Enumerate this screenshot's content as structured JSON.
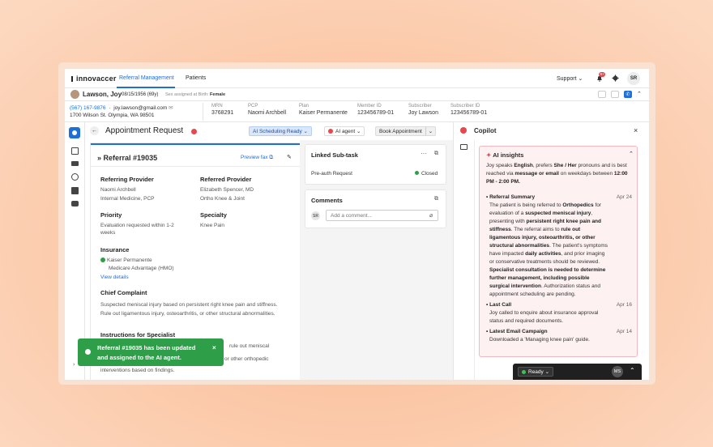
{
  "nav": {
    "brand": "innovaccer",
    "links": [
      "Referral Management",
      "Patients"
    ],
    "support": "Support",
    "notif_badge": "9+",
    "user_initials": "SR"
  },
  "patient": {
    "name": "Lawson, Joy",
    "dob": "08/15/1956 (69y)",
    "sex_label": "Sex assigned at Birth:",
    "sex_value": "Female",
    "phone": "(567) 167-9876",
    "email": "joy.lawson@gmail.com",
    "address": "1700 Wilson St. Olympia, WA 98501",
    "fields": [
      {
        "label": "MRN",
        "value": "3768291"
      },
      {
        "label": "PCP",
        "value": "Naomi Archbell"
      },
      {
        "label": "Plan",
        "value": "Kaiser Permanente"
      },
      {
        "label": "Member ID",
        "value": "123456789-01"
      },
      {
        "label": "Subscriber",
        "value": "Joy Lawson"
      },
      {
        "label": "Subscriber ID",
        "value": "123456789-01"
      }
    ]
  },
  "page": {
    "title": "Appointment Request",
    "status_btn": "AI Scheduling Ready",
    "agent_btn": "AI agent",
    "book_btn": "Book Appointment"
  },
  "referral": {
    "id": "Referral #19035",
    "preview": "Preview fax",
    "referring_provider_label": "Referring Provider",
    "referring_provider": "Naomi Archbell",
    "referring_specialty": "Internal Medicine, PCP",
    "referred_provider_label": "Referred Provider",
    "referred_provider": "Elizabeth Spencer, MD",
    "referred_specialty": "Ortho Knee & Joint",
    "priority_label": "Priority",
    "priority": "Evaluation requested within 1-2 weeks",
    "specialty_label": "Specialty",
    "specialty": "Knee Pain",
    "insurance_label": "Insurance",
    "insurance_name": "Kaiser Permanente",
    "insurance_plan": "Medicare Advantage (HMO)",
    "view_details": "View details",
    "complaint_label": "Chief Complaint",
    "complaint": "Suspected meniscal injury based on persistent right knee pain and stiffness. Rule out ligamentous injury, osteoarthritis, or other structural abnormalities.",
    "instructions_label": "Instructions for Specialist",
    "instructions_1": "rule out meniscal",
    "instructions_2": "or other orthopedic",
    "instructions_3": "interventions based on findings."
  },
  "subtask": {
    "title": "Linked Sub-task",
    "item": "Pre-auth Request",
    "status": "Closed"
  },
  "comments": {
    "title": "Comments",
    "avatar": "SR",
    "placeholder": "Add a comment..."
  },
  "copilot": {
    "title": "Copilot",
    "insights_title": "AI insights",
    "intro": [
      {
        "t": "Joy speaks ",
        "b": false
      },
      {
        "t": "English",
        "b": true
      },
      {
        "t": ", prefers ",
        "b": false
      },
      {
        "t": "She / Her",
        "b": true
      },
      {
        "t": " pronouns and is best reached via ",
        "b": false
      },
      {
        "t": "message or email",
        "b": true
      },
      {
        "t": " on weekdays between ",
        "b": false
      },
      {
        "t": "12:00 PM - 2:00 PM.",
        "b": true
      }
    ],
    "items": [
      {
        "title": "Referral Summary",
        "date": "Apr 24",
        "parts": [
          {
            "t": "The patient is being referred to ",
            "b": false
          },
          {
            "t": "Orthopedics",
            "b": true
          },
          {
            "t": " for evaluation of a ",
            "b": false
          },
          {
            "t": "suspected meniscal injury",
            "b": true
          },
          {
            "t": ", presenting with ",
            "b": false
          },
          {
            "t": "persistent right knee pain and stiffness",
            "b": true
          },
          {
            "t": ". The referral aims to ",
            "b": false
          },
          {
            "t": "rule out ligamentous injury, osteoarthritis, or other structural abnormalities",
            "b": true
          },
          {
            "t": ". The patient's symptoms have impacted ",
            "b": false
          },
          {
            "t": "daily activities",
            "b": true
          },
          {
            "t": ", and prior imaging or conservative treatments should be reviewed. ",
            "b": false
          },
          {
            "t": "Specialist consultation is needed to determine further management, including possible surgical intervention",
            "b": true
          },
          {
            "t": ". Authorization status and appointment scheduling are pending.",
            "b": false
          }
        ]
      },
      {
        "title": "Last Call",
        "date": "Apr 16",
        "parts": [
          {
            "t": "Joy called to enquire about insurance approval status and required documents.",
            "b": false
          }
        ]
      },
      {
        "title": "Latest Email Campaign",
        "date": "Apr 14",
        "parts": [
          {
            "t": "Downloaded a 'Managing knee pain' guide.",
            "b": false
          }
        ]
      }
    ]
  },
  "toast": {
    "line1": "Referral #19035 has been updated",
    "line2": "and assigned to the AI agent."
  },
  "readybar": {
    "status": "Ready",
    "initials": "MS"
  },
  "colors": {
    "accent": "#1e6fd9",
    "success": "#2e9e48",
    "danger": "#e5484d",
    "insight_bg": "#fdf1f2"
  }
}
